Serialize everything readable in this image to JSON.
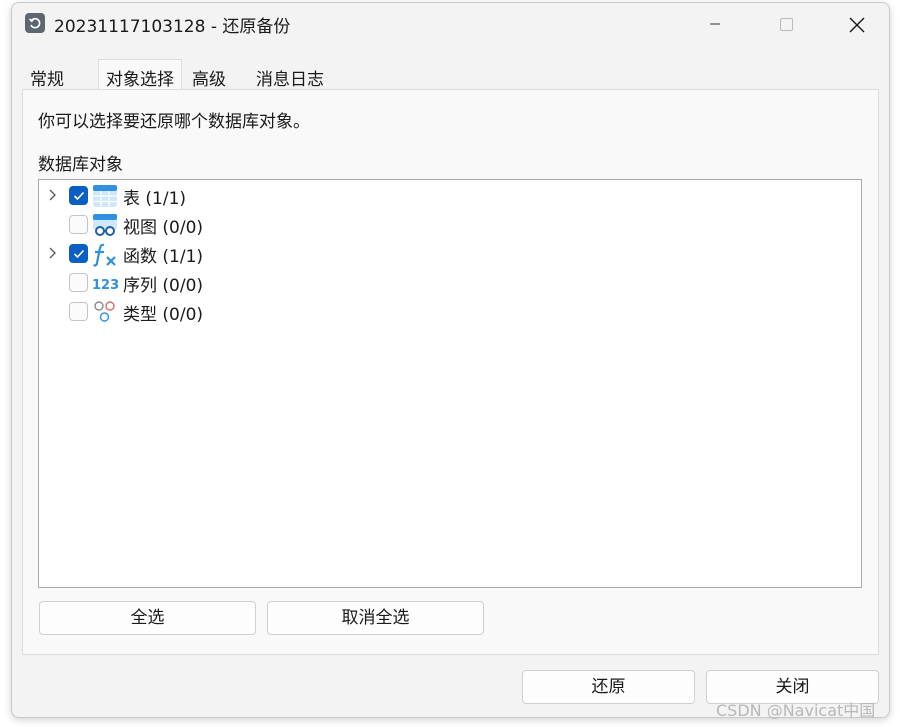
{
  "window": {
    "title": "20231117103128 - 还原备份",
    "icon": "restore-icon"
  },
  "title_buttons": {
    "minimize_icon": "minimize-icon",
    "maximize_icon": "maximize-icon",
    "close_icon": "close-icon"
  },
  "tabs": [
    {
      "label": "常规",
      "active": false
    },
    {
      "label": "对象选择",
      "active": true
    },
    {
      "label": "高级",
      "active": false
    },
    {
      "label": "消息日志",
      "active": false
    }
  ],
  "panel": {
    "instruction": "你可以选择要还原哪个数据库对象。",
    "section_label": "数据库对象",
    "tree": [
      {
        "label": "表 (1/1)",
        "checked": true,
        "expandable": true,
        "icon": "table-icon"
      },
      {
        "label": "视图 (0/0)",
        "checked": false,
        "expandable": false,
        "icon": "view-icon"
      },
      {
        "label": "函数 (1/1)",
        "checked": true,
        "expandable": true,
        "icon": "function-icon"
      },
      {
        "label": "序列 (0/0)",
        "checked": false,
        "expandable": false,
        "icon": "sequence-icon"
      },
      {
        "label": "类型 (0/0)",
        "checked": false,
        "expandable": false,
        "icon": "type-icon"
      }
    ],
    "select_all_label": "全选",
    "deselect_all_label": "取消全选"
  },
  "footer": {
    "restore_label": "还原",
    "close_label": "关闭"
  },
  "watermark": "CSDN @Navicat中国",
  "colors": {
    "accent": "#0a5ec4",
    "window_bg": "#f3f3f3",
    "panel_bg": "#f9f9f9",
    "tree_icon_blue": "#2f8fe0",
    "watermark": "#b8b8b8"
  }
}
